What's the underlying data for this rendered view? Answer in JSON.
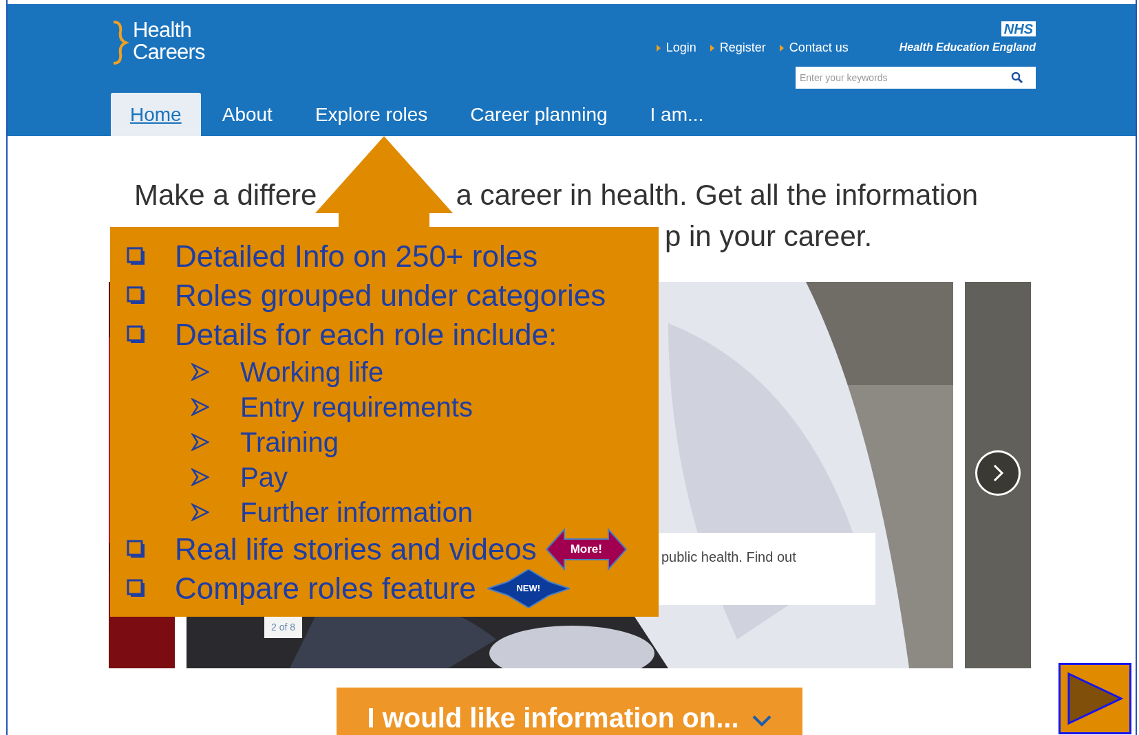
{
  "header": {
    "logo": {
      "line_1": "Health",
      "line_2": "Careers"
    },
    "top_links": [
      "Login",
      "Register",
      "Contact us"
    ],
    "org": {
      "badge": "NHS",
      "name": "Health Education England"
    },
    "search": {
      "placeholder": "Enter your keywords"
    },
    "nav": [
      {
        "label": "Home",
        "selected": true
      },
      {
        "label": "About",
        "selected": false
      },
      {
        "label": "Explore roles",
        "selected": false
      },
      {
        "label": "Career planning",
        "selected": false
      },
      {
        "label": "I am...",
        "selected": false
      }
    ]
  },
  "tagline": {
    "line_1_parts": [
      "Make a differe",
      "a career in health. Get all the information"
    ],
    "line_2_parts": [
      "p in your career."
    ]
  },
  "carousel": {
    "caption": "public health. Find out",
    "counter": "2 of 8"
  },
  "callout": {
    "items": [
      {
        "kind": "main",
        "text": "Detailed Info on 250+ roles"
      },
      {
        "kind": "main",
        "text": "Roles grouped under categories"
      },
      {
        "kind": "main",
        "text": "Details for each role include:"
      },
      {
        "kind": "sub",
        "text": "Working life"
      },
      {
        "kind": "sub",
        "text": "Entry requirements"
      },
      {
        "kind": "sub",
        "text": "Training"
      },
      {
        "kind": "sub",
        "text": "Pay"
      },
      {
        "kind": "sub",
        "text": "Further information"
      },
      {
        "kind": "main",
        "text": "Real life stories and videos",
        "badge": {
          "kind": "double-arrow",
          "text": "More!"
        }
      },
      {
        "kind": "main",
        "text": "Compare roles feature",
        "badge": {
          "kind": "burst",
          "text": "NEW!"
        }
      }
    ]
  },
  "info_bar": {
    "label": "I would like information on..."
  }
}
